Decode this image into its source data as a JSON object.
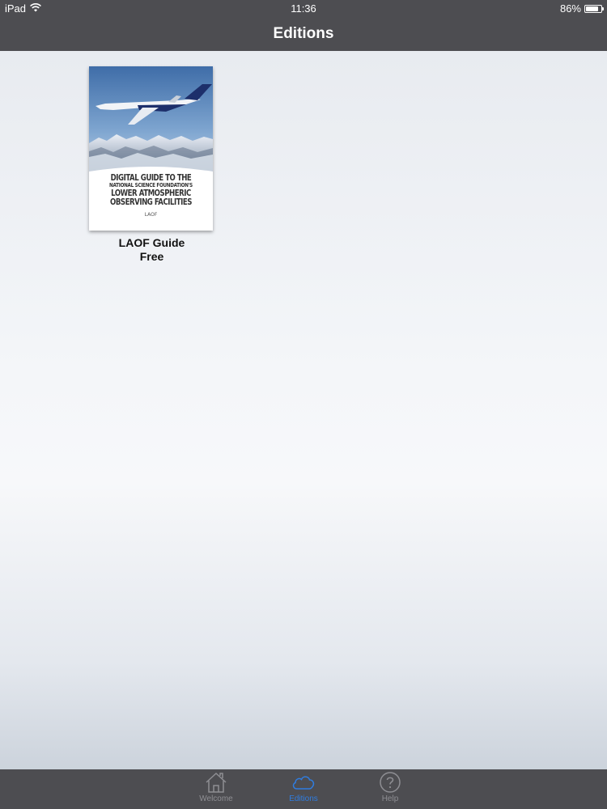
{
  "status_bar": {
    "device": "iPad",
    "time": "11:36",
    "battery": "86%",
    "battery_level": 0.86
  },
  "nav": {
    "title": "Editions"
  },
  "editions": [
    {
      "cover": {
        "line1": "DIGITAL GUIDE TO THE",
        "line2": "NATIONAL SCIENCE FOUNDATION'S",
        "line3": "LOWER ATMOSPHERIC",
        "line4": "OBSERVING FACILITIES",
        "logo_text": "LAOF"
      },
      "title": "LAOF Guide",
      "price": "Free"
    }
  ],
  "tabs": [
    {
      "label": "Welcome",
      "icon": "home-icon",
      "active": false
    },
    {
      "label": "Editions",
      "icon": "cloud-icon",
      "active": true
    },
    {
      "label": "Help",
      "icon": "help-circle-icon",
      "active": false
    }
  ],
  "colors": {
    "bar": "#4d4d51",
    "tab_inactive": "#8e8e93",
    "tab_active": "#2f7de1"
  }
}
